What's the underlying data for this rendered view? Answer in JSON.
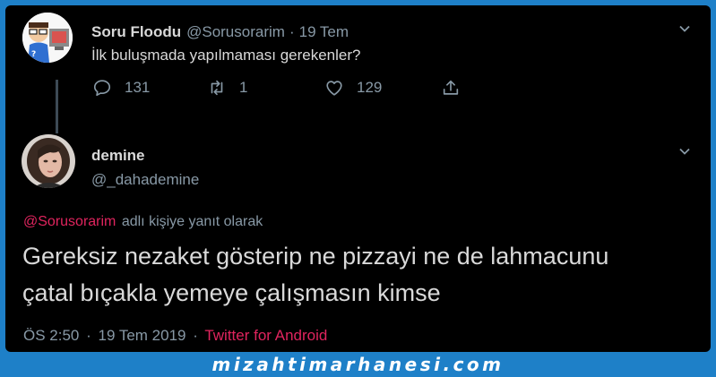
{
  "parent_tweet": {
    "name": "Soru Floodu",
    "handle": "@Sorusorarim",
    "separator": "·",
    "date": "19 Tem",
    "text": "İlk buluşmada yapılmaması gerekenler?",
    "actions": {
      "replies": "131",
      "retweets": "1",
      "likes": "129"
    }
  },
  "reply_tweet": {
    "name": "demine",
    "handle": "@_dahademine",
    "reply_to_handle": "@Sorusorarim",
    "reply_to_suffix": "adlı kişiye yanıt olarak",
    "text_line1": "Gereksiz nezaket gösterip ne pizzayi ne de lahmacunu",
    "text_line2": "çatal bıçakla yemeye çalışmasın kimse",
    "time": "ÖS 2:50",
    "date": "19 Tem 2019",
    "separator": "·",
    "source": "Twitter for Android"
  },
  "watermark": "mizahtimarhanesi.com",
  "colors": {
    "background": "#000000",
    "border": "#1e80c8",
    "text": "#d9d9d9",
    "muted": "#8899a6",
    "link": "#e0245e"
  },
  "icons": [
    "reply-icon",
    "retweet-icon",
    "like-icon",
    "share-icon",
    "chevron-down-icon"
  ]
}
